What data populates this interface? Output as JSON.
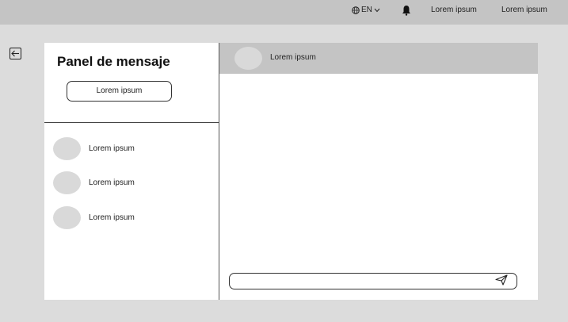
{
  "topbar": {
    "language": "EN",
    "link1": "Lorem ipsum",
    "link2": "Lorem ipsum",
    "icons": [
      "globe-icon",
      "chevron-down-icon",
      "bell-icon"
    ]
  },
  "back_icon": "arrow-left-icon",
  "panel": {
    "title": "Panel de mensaje",
    "button_label": "Lorem ipsum",
    "contacts": [
      {
        "name": "Lorem ipsum"
      },
      {
        "name": "Lorem ipsum"
      },
      {
        "name": "Lorem ipsum"
      }
    ]
  },
  "chat": {
    "header_name": "Lorem ipsum",
    "input_value": "",
    "send_icon": "send-icon"
  },
  "colors": {
    "background": "#dcdcdc",
    "topbar": "#c4c4c4",
    "panel": "#ffffff",
    "avatar": "#d9d9d9"
  }
}
